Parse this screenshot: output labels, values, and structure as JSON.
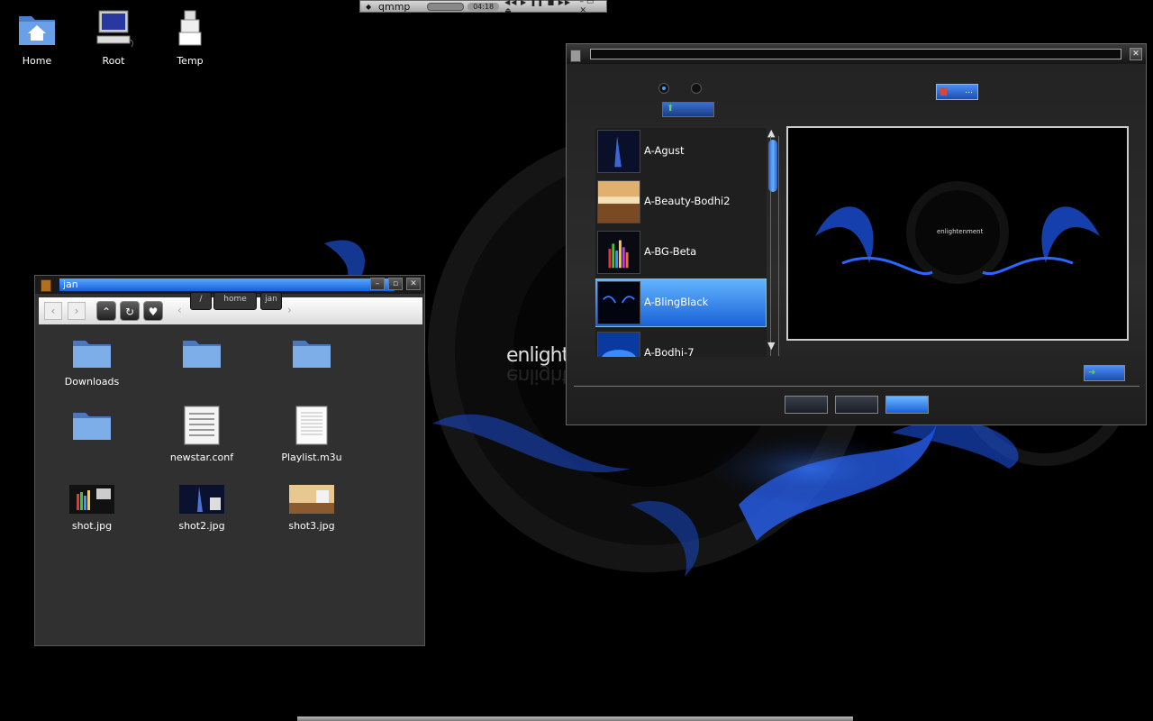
{
  "desktop": {
    "icons": [
      {
        "label": "Home",
        "icon": "home-folder-icon"
      },
      {
        "label": "Root",
        "icon": "computer-icon"
      },
      {
        "label": "Temp",
        "icon": "temp-folder-icon"
      }
    ]
  },
  "qmmp": {
    "title": "qmmp",
    "time": "04:18"
  },
  "file_manager": {
    "title": "jan",
    "breadcrumb": [
      "/",
      "home",
      "jan"
    ],
    "files": [
      {
        "name": "Downloads",
        "type": "folder"
      },
      {
        "name": "",
        "type": "folder"
      },
      {
        "name": "",
        "type": "folder"
      },
      {
        "name": "",
        "type": "folder"
      },
      {
        "name": "newstar.conf",
        "type": "config"
      },
      {
        "name": "Playlist.m3u",
        "type": "document"
      },
      {
        "name": "shot.jpg",
        "type": "image"
      },
      {
        "name": "shot2.jpg",
        "type": "image"
      },
      {
        "name": "shot3.jpg",
        "type": "image"
      }
    ]
  },
  "theme_dialog": {
    "title": "",
    "themes": [
      {
        "name": "A-Agust",
        "selected": false
      },
      {
        "name": "A-Beauty-Bodhi2",
        "selected": false
      },
      {
        "name": "A-BG-Beta",
        "selected": false
      },
      {
        "name": "A-BlingBlack",
        "selected": true
      },
      {
        "name": "A-Bodhi-7",
        "selected": false
      }
    ],
    "import_label": "...",
    "preview_logo": "enlightenment"
  },
  "wallpaper": {
    "logo": "enlightenment"
  },
  "colors": {
    "accent": "#2a7ae8",
    "background": "#000000",
    "window_bg": "#303030"
  }
}
